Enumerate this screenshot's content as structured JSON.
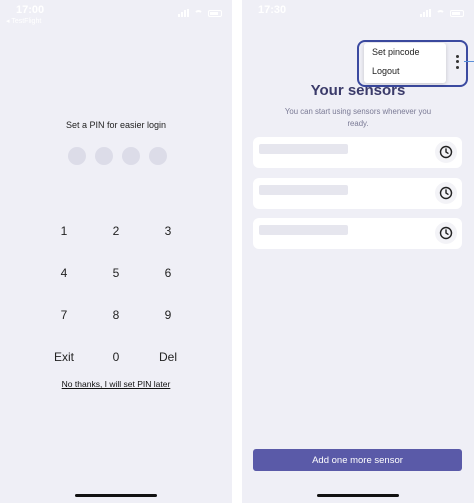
{
  "left_screen": {
    "status_bar": {
      "time": "17:00",
      "carrier": "◂ TestFlight"
    },
    "pin_title": "Set a PIN for easier login",
    "keypad": [
      "1",
      "2",
      "3",
      "4",
      "5",
      "6",
      "7",
      "8",
      "9",
      "Exit",
      "0",
      "Del"
    ],
    "skip_link": "No thanks, I will set PIN later"
  },
  "right_screen": {
    "status_bar": {
      "time": "17:30"
    },
    "menu": {
      "items": [
        "Set pincode",
        "Logout"
      ]
    },
    "title": "Your sensors",
    "subtitle": "You can start using sensors whenever you ready.",
    "add_button": "Add one more sensor"
  },
  "colors": {
    "background": "#efeff6",
    "primary_button": "#5a5aa8",
    "title": "#3b3b6a",
    "highlight_border": "#3b4aa0"
  },
  "icons": {
    "sensor_action": "clock-icon",
    "menu_toggle": "more-vertical-icon"
  }
}
